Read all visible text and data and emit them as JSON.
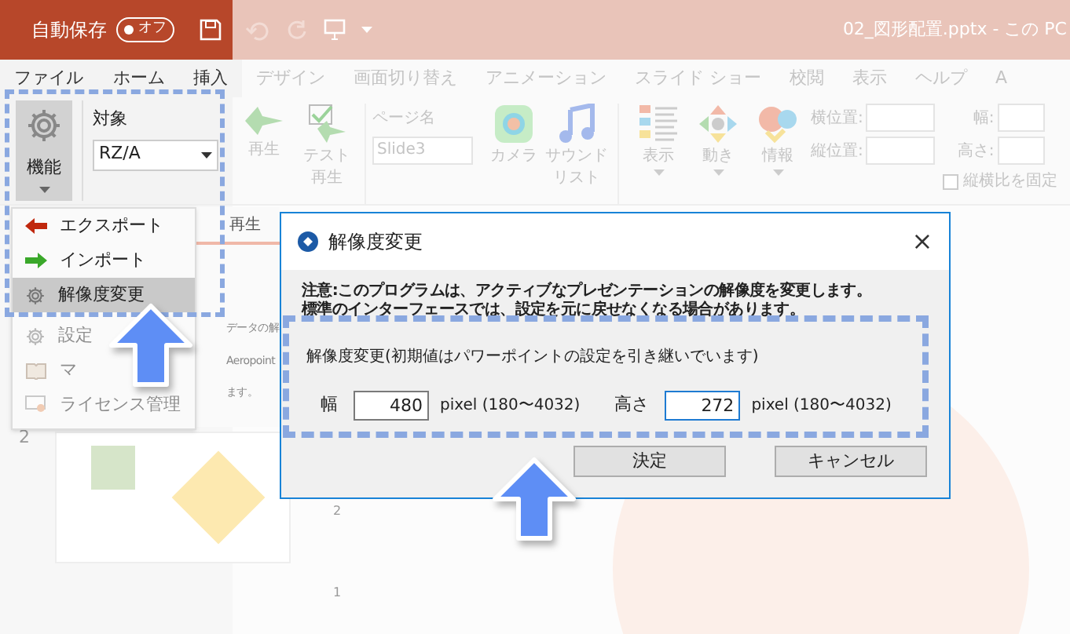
{
  "title_bar": {
    "autosave_label": "自動保存",
    "autosave_toggle": {
      "label": "オフ",
      "on": false
    },
    "document_title": "02_図形配置.pptx - この PC"
  },
  "tabs": [
    {
      "label": "ファイル",
      "highlighted": true
    },
    {
      "label": "ホーム",
      "highlighted": true
    },
    {
      "label": "挿入",
      "highlighted": true
    },
    {
      "label": "デザイン",
      "highlighted": false
    },
    {
      "label": "画面切り替え",
      "highlighted": false
    },
    {
      "label": "アニメーション",
      "highlighted": false
    },
    {
      "label": "スライド ショー",
      "highlighted": false
    },
    {
      "label": "校閲",
      "highlighted": false
    },
    {
      "label": "表示",
      "highlighted": false
    },
    {
      "label": "ヘルプ",
      "highlighted": false
    },
    {
      "label": "A",
      "highlighted": false
    }
  ],
  "ribbon": {
    "function_button": "機能",
    "target_label": "対象",
    "target_value": "RZ/A",
    "large_buttons": [
      {
        "kind": "play",
        "lines": [
          "再生"
        ]
      },
      {
        "kind": "test",
        "lines": [
          "テスト",
          "再生"
        ]
      }
    ],
    "page_name": {
      "label": "ページ名",
      "value": "Slide3"
    },
    "media_buttons": [
      {
        "kind": "camera",
        "lines": [
          "カメラ"
        ]
      },
      {
        "kind": "sound",
        "lines": [
          "サウンド",
          "リスト"
        ]
      }
    ],
    "menu_buttons": [
      {
        "kind": "view",
        "label": "表示"
      },
      {
        "kind": "motion",
        "label": "動き"
      },
      {
        "kind": "info",
        "label": "情報"
      }
    ],
    "position_fields": [
      {
        "label": "横位置:"
      },
      {
        "label": "縦位置:"
      }
    ],
    "size_fields": [
      {
        "label": "幅:"
      },
      {
        "label": "高さ:"
      }
    ],
    "lock_aspect": {
      "label": "縦横比を固定",
      "checked": false
    }
  },
  "function_menu": [
    {
      "kind": "export",
      "label": "エクスポート",
      "selected": false,
      "dimmed": false
    },
    {
      "kind": "import",
      "label": "インポート",
      "selected": false,
      "dimmed": false
    },
    {
      "kind": "gear",
      "label": "解像度変更",
      "selected": true,
      "dimmed": false
    },
    {
      "kind": "gear",
      "label": "設定",
      "selected": false,
      "dimmed": true
    },
    {
      "kind": "book",
      "label": "マ",
      "selected": false,
      "dimmed": true
    },
    {
      "kind": "certificate",
      "label": "ライセンス管理",
      "selected": false,
      "dimmed": true
    }
  ],
  "task_pane": {
    "tab": "再生",
    "lines": [
      "データの解",
      "Aeropoint",
      "ます。"
    ]
  },
  "ruler_marks": [
    "2",
    "1"
  ],
  "slide_thumbnail": {
    "number": "2"
  },
  "dialog": {
    "title": "解像度変更",
    "close": "×",
    "notice": [
      "注意:このプログラムは、アクティブなプレゼンテーションの解像度を変更します。",
      "標準のインターフェースでは、設定を元に戻せなくなる場合があります。"
    ],
    "group_label": "解像度変更(初期値はパワーポイントの設定を引き継いでいます)",
    "fields": [
      {
        "label": "幅",
        "value": "480",
        "unit": "pixel (180〜4032)",
        "focused": false
      },
      {
        "label": "高さ",
        "value": "272",
        "unit": "pixel (180〜4032)",
        "focused": true
      }
    ],
    "buttons": [
      "決定",
      "キャンセル"
    ]
  }
}
